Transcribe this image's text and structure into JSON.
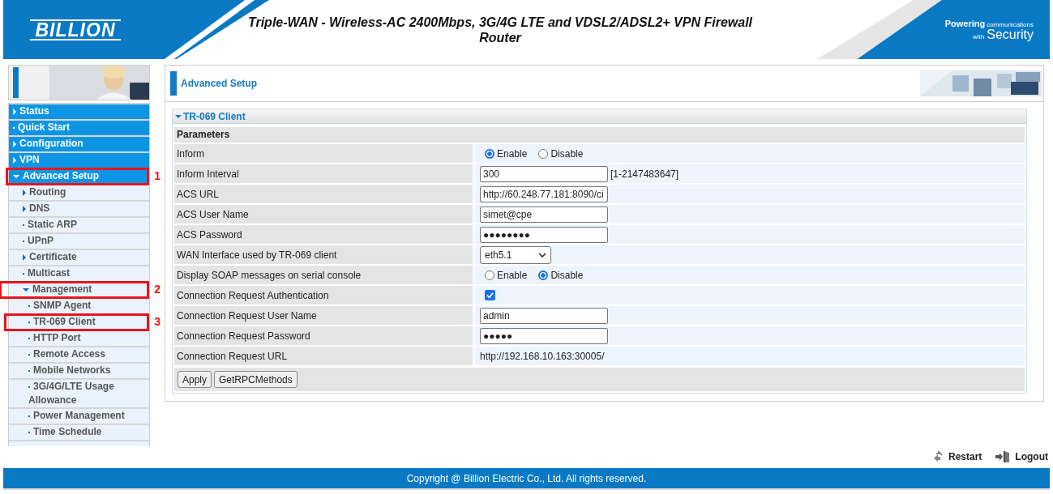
{
  "header": {
    "logo": "BILLION",
    "title": "Triple-WAN - Wireless-AC 2400Mbps, 3G/4G LTE and VDSL2/ADSL2+ VPN Firewall Router",
    "slogan_top": "Powering",
    "slogan_small": "communications",
    "slogan_with": "with",
    "slogan_big": "Security"
  },
  "sidebar": {
    "items": [
      {
        "label": "Status",
        "kind": "group",
        "expanded": false
      },
      {
        "label": "Quick Start",
        "kind": "page"
      },
      {
        "label": "Configuration",
        "kind": "group",
        "expanded": false
      },
      {
        "label": "VPN",
        "kind": "group",
        "expanded": false
      },
      {
        "label": "Advanced Setup",
        "kind": "group",
        "expanded": true,
        "callout": "1",
        "children": [
          {
            "label": "Routing",
            "kind": "group",
            "expanded": false
          },
          {
            "label": "DNS",
            "kind": "group",
            "expanded": false
          },
          {
            "label": "Static ARP",
            "kind": "page"
          },
          {
            "label": "UPnP",
            "kind": "page"
          },
          {
            "label": "Certificate",
            "kind": "group",
            "expanded": false
          },
          {
            "label": "Multicast",
            "kind": "page"
          },
          {
            "label": "Management",
            "kind": "group",
            "expanded": true,
            "callout": "2",
            "children": [
              {
                "label": "SNMP Agent",
                "kind": "page"
              },
              {
                "label": "TR-069 Client",
                "kind": "page",
                "callout": "3"
              },
              {
                "label": "HTTP Port",
                "kind": "page"
              },
              {
                "label": "Remote Access",
                "kind": "page"
              },
              {
                "label": "Mobile Networks",
                "kind": "page"
              },
              {
                "label": "3G/4G/LTE Usage Allowance",
                "kind": "page"
              },
              {
                "label": "Power Management",
                "kind": "page"
              },
              {
                "label": "Time Schedule",
                "kind": "page"
              }
            ]
          }
        ]
      }
    ]
  },
  "page": {
    "title": "Advanced Setup",
    "section": "TR-069 Client",
    "group": "Parameters",
    "rows": [
      {
        "label": "Inform",
        "kind": "radio",
        "options": [
          {
            "label": "Enable",
            "selected": true
          },
          {
            "label": "Disable",
            "selected": false
          }
        ]
      },
      {
        "label": "Inform Interval",
        "kind": "text",
        "value": "300",
        "hint": "[1-2147483647]"
      },
      {
        "label": "ACS URL",
        "kind": "text",
        "value": "http://60.248.77.181:8090/ci"
      },
      {
        "label": "ACS User Name",
        "kind": "text",
        "value": "simet@cpe"
      },
      {
        "label": "ACS Password",
        "kind": "text",
        "value": "●●●●●●●●"
      },
      {
        "label": "WAN Interface used by TR-069 client",
        "kind": "select",
        "value": "eth5.1"
      },
      {
        "label": "Display SOAP messages on serial console",
        "kind": "radio",
        "options": [
          {
            "label": "Enable",
            "selected": false
          },
          {
            "label": "Disable",
            "selected": true
          }
        ]
      },
      {
        "label": "Connection Request Authentication",
        "kind": "checkbox",
        "checked": true
      },
      {
        "label": "Connection Request User Name",
        "kind": "text",
        "value": "admin"
      },
      {
        "label": "Connection Request Password",
        "kind": "text",
        "value": "●●●●●"
      },
      {
        "label": "Connection Request URL",
        "kind": "static",
        "value": "http://192.168.10.163:30005/"
      }
    ],
    "buttons": [
      "Apply",
      "GetRPCMethods"
    ]
  },
  "actions": [
    "Restart",
    "Logout"
  ],
  "footer": "Copyright @ Billion Electric Co., Ltd. All rights reserved."
}
